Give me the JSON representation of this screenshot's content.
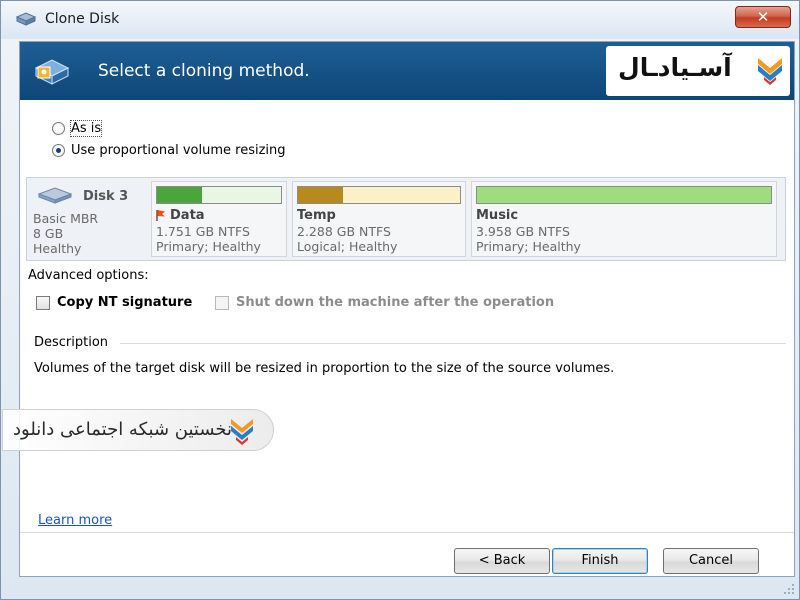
{
  "window": {
    "title": "Clone Disk",
    "close_symbol": "✕"
  },
  "header": {
    "title": "Select a cloning method.",
    "brand_text": "آسـيادـال"
  },
  "options": {
    "as_is": "As is",
    "proportional": "Use proportional volume resizing",
    "selected": "proportional"
  },
  "disk": {
    "name": "Disk 3",
    "type": "Basic MBR",
    "size": "8 GB",
    "status": "Healthy",
    "volumes": [
      {
        "name": "Data",
        "size": "1.751 GB NTFS",
        "status": "Primary; Healthy",
        "used_fraction": 0.36,
        "color": "#4aa53b"
      },
      {
        "name": "Temp",
        "size": "2.288 GB NTFS",
        "status": "Logical; Healthy",
        "used_fraction": 0.28,
        "color": "#b88a1e"
      },
      {
        "name": "Music",
        "size": "3.958 GB NTFS",
        "status": "Primary; Healthy",
        "used_fraction": 0.0,
        "color": "#4aa53b"
      }
    ]
  },
  "advanced": {
    "label": "Advanced options:",
    "copy_nt": "Copy NT signature",
    "shutdown": "Shut down the machine after the operation"
  },
  "description": {
    "heading": "Description",
    "text": "Volumes of the target disk will be resized in proportion to the size of the source volumes."
  },
  "watermark": {
    "text": "نخستین شبکه اجتماعی دانلود"
  },
  "footer": {
    "learn_more": "Learn more",
    "back": "< Back",
    "finish": "Finish",
    "cancel": "Cancel"
  },
  "colors": {
    "header_band": "#0e4678",
    "accent_orange": "#f29a1e",
    "accent_blue": "#2a7dc8",
    "accent_red": "#d83b2a"
  }
}
